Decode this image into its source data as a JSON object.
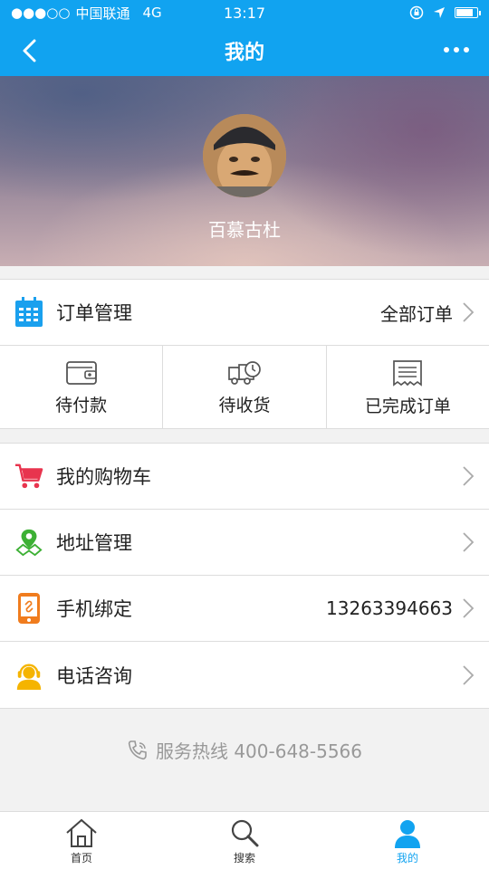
{
  "status": {
    "signal": "●●●○○",
    "carrier": "中国联通",
    "network": "4G",
    "time": "13:17"
  },
  "nav": {
    "title": "我的"
  },
  "profile": {
    "name": "百慕古杜"
  },
  "order": {
    "label": "订单管理",
    "all_label": "全部订单",
    "tabs": [
      {
        "label": "待付款",
        "icon": "wallet-icon"
      },
      {
        "label": "待收货",
        "icon": "delivery-truck-icon"
      },
      {
        "label": "已完成订单",
        "icon": "receipt-icon"
      }
    ]
  },
  "menu": [
    {
      "label": "我的购物车",
      "icon": "shopping-cart-icon",
      "value": ""
    },
    {
      "label": "地址管理",
      "icon": "map-pin-icon",
      "value": ""
    },
    {
      "label": "手机绑定",
      "icon": "phone-link-icon",
      "value": "13263394663"
    },
    {
      "label": "电话咨询",
      "icon": "customer-service-icon",
      "value": ""
    }
  ],
  "hotline": "服务热线 400-648-5566",
  "tabbar": [
    {
      "label": "首页",
      "icon": "home-icon"
    },
    {
      "label": "搜索",
      "icon": "search-icon"
    },
    {
      "label": "我的",
      "icon": "user-icon"
    }
  ],
  "colors": {
    "accent": "#11a3f0",
    "cart": "#e8344e",
    "pin": "#3cb034",
    "phone": "#f07c1e",
    "service": "#f5b400"
  }
}
